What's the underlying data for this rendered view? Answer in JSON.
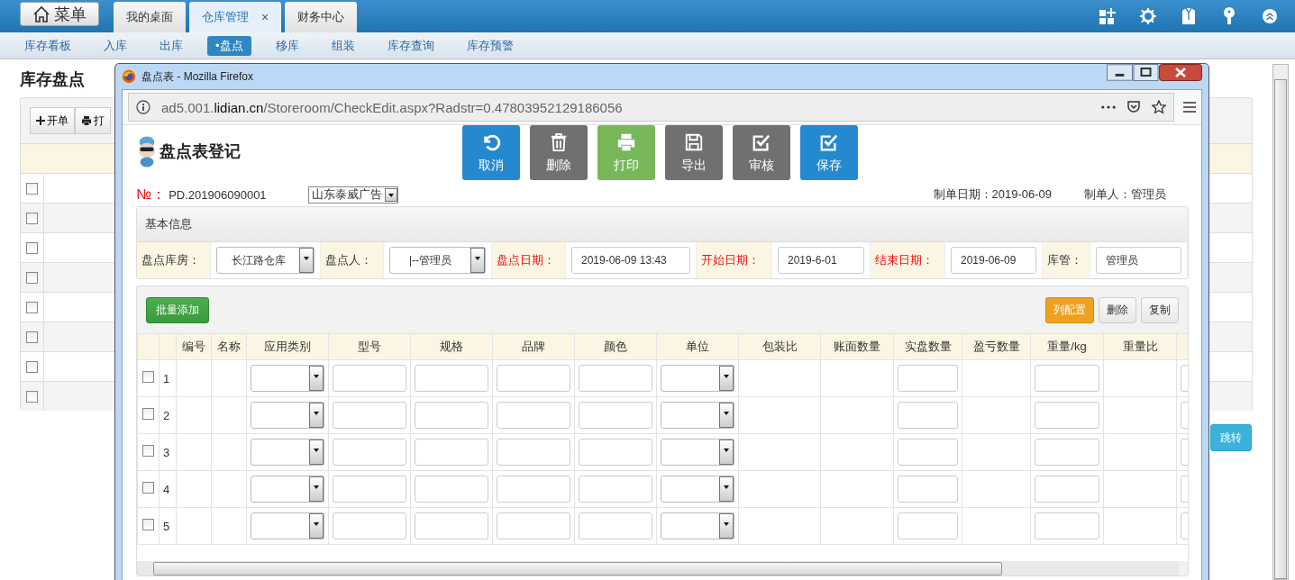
{
  "app": {
    "menu_button": "菜单",
    "tabs": [
      {
        "label": "我的桌面",
        "selected": false
      },
      {
        "label": "仓库管理",
        "selected": true,
        "close": "×"
      },
      {
        "label": "财务中心",
        "selected": false
      }
    ],
    "subnav": [
      {
        "label": "库存看板",
        "selected": false
      },
      {
        "label": "入库",
        "selected": false
      },
      {
        "label": "出库",
        "selected": false
      },
      {
        "label": "•盘点",
        "selected": true
      },
      {
        "label": "移库",
        "selected": false
      },
      {
        "label": "组装",
        "selected": false
      },
      {
        "label": "库存查询",
        "selected": false
      },
      {
        "label": "库存预警",
        "selected": false
      }
    ],
    "page_title": "库存盘点",
    "toolbar": [
      {
        "label": "开单"
      },
      {
        "label": "打"
      }
    ],
    "list_rows": [
      {
        "checked": false
      },
      {
        "checked": false
      },
      {
        "checked": false
      },
      {
        "checked": false
      },
      {
        "checked": false
      },
      {
        "checked": false
      },
      {
        "checked": false
      },
      {
        "checked": false
      }
    ],
    "jump_button": "跳转"
  },
  "browser": {
    "title": "盘点表 - Mozilla Firefox",
    "url_prefix": "ad5.001.",
    "url_domain": "lidian.cn",
    "url_path": "/Storeroom/CheckEdit.aspx?Radstr=0.47803952129186056"
  },
  "form": {
    "title": "盘点表登记",
    "actions": [
      {
        "label": "取消",
        "color": "#2589d0"
      },
      {
        "label": "删除",
        "color": "#707070"
      },
      {
        "label": "打印",
        "color": "#78b85a"
      },
      {
        "label": "导出",
        "color": "#707070"
      },
      {
        "label": "审核",
        "color": "#707070"
      },
      {
        "label": "保存",
        "color": "#2589d0"
      }
    ],
    "number_label": "№：",
    "number": "PD.201906090001",
    "company": "山东泰威广告",
    "created_date": "制单日期：2019-06-09",
    "creator": "制单人：管理员",
    "basic_info": {
      "title": "基本信息",
      "fields": [
        {
          "label": "盘点库房：",
          "value": "长江路仓库",
          "kind": "select",
          "required": false
        },
        {
          "label": "盘点人：",
          "value": "|--管理员",
          "kind": "select",
          "required": false
        },
        {
          "label": "盘点日期：",
          "value": "2019-06-09 13:43",
          "kind": "input",
          "required": true
        },
        {
          "label": "开始日期：",
          "value": "2019-6-01",
          "kind": "input",
          "required": true
        },
        {
          "label": "结束日期：",
          "value": "2019-06-09",
          "kind": "input",
          "required": true
        },
        {
          "label": "库管：",
          "value": "管理员",
          "kind": "input",
          "required": false
        }
      ]
    },
    "grid": {
      "add_button": "批量添加",
      "buttons": [
        {
          "label": "列配置",
          "kind": "accent"
        },
        {
          "label": "删除",
          "kind": "plain"
        },
        {
          "label": "复制",
          "kind": "plain"
        }
      ],
      "columns": [
        {
          "kind": "check"
        },
        {
          "kind": "index"
        },
        {
          "label": "编号",
          "kind": "text"
        },
        {
          "label": "名称",
          "kind": "text"
        },
        {
          "label": "应用类别",
          "kind": "select"
        },
        {
          "label": "型号",
          "kind": "input"
        },
        {
          "label": "规格",
          "kind": "input"
        },
        {
          "label": "品牌",
          "kind": "input"
        },
        {
          "label": "颜色",
          "kind": "input"
        },
        {
          "label": "单位",
          "kind": "select"
        },
        {
          "label": "包装比",
          "kind": "text"
        },
        {
          "label": "账面数量",
          "kind": "text"
        },
        {
          "label": "实盘数量",
          "kind": "input"
        },
        {
          "label": "盈亏数量",
          "kind": "text"
        },
        {
          "label": "重量/kg",
          "kind": "input"
        },
        {
          "label": "重量比",
          "kind": "text"
        },
        {
          "kind": "input"
        }
      ],
      "rows": [
        {
          "index": "1",
          "checked": false
        },
        {
          "index": "2",
          "checked": false
        },
        {
          "index": "3",
          "checked": false
        },
        {
          "index": "4",
          "checked": false
        },
        {
          "index": "5",
          "checked": false
        }
      ]
    }
  }
}
